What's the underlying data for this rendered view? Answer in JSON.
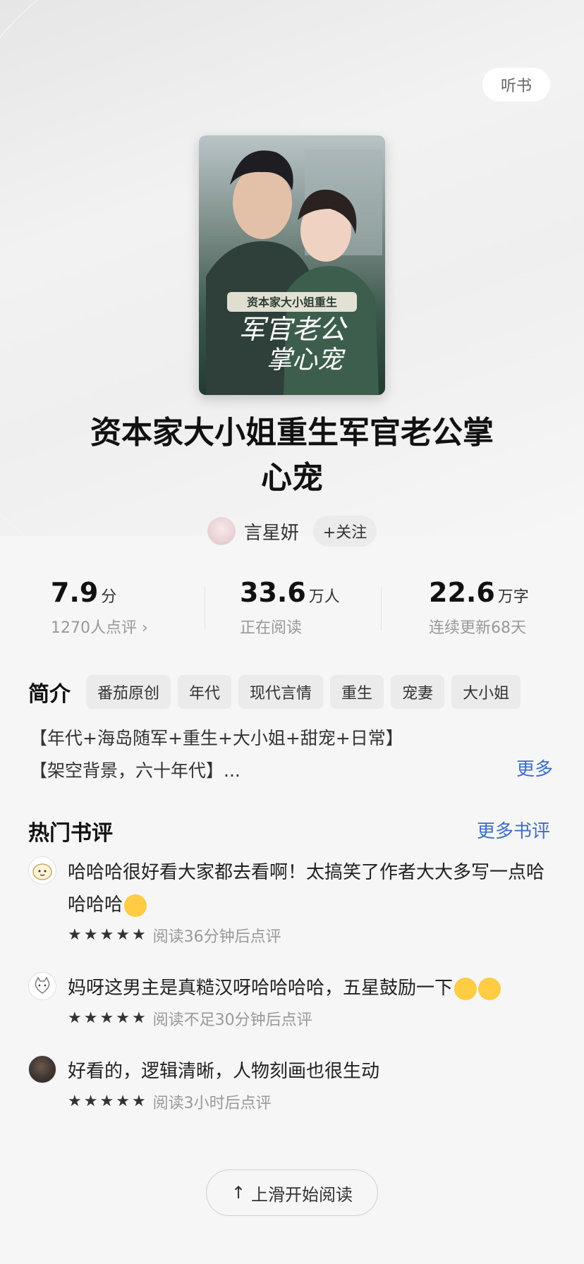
{
  "header": {
    "listen_label": "听书"
  },
  "book": {
    "cover_small_title": "资本家大小姐重生",
    "cover_big_title_1": "军官老公",
    "cover_big_title_2": "掌心宠",
    "title": "资本家大小姐重生军官老公掌心宠"
  },
  "author": {
    "name": "言星妍",
    "follow_label": "+关注"
  },
  "stats": {
    "score": "7.9",
    "score_unit": "分",
    "score_sub": "1270人点评 ›",
    "readers": "33.6",
    "readers_unit": "万人",
    "readers_sub": "正在阅读",
    "words": "22.6",
    "words_unit": "万字",
    "words_sub": "连续更新68天"
  },
  "intro": {
    "label": "简介",
    "tags": [
      "番茄原创",
      "年代",
      "现代言情",
      "重生",
      "宠妻",
      "大小姐"
    ],
    "line1": "【年代+海岛随军+重生+大小姐+甜宠+日常】",
    "line2": "【架空背景，六十年代】...",
    "more_label": "更多"
  },
  "reviews": {
    "title": "热门书评",
    "more_label": "更多书评",
    "items": [
      {
        "text": "哈哈哈很好看大家都去看啊！太搞笑了作者大大多写一点哈哈哈哈",
        "meta": "阅读36分钟后点评",
        "avatar_icon": "bun-avatar-icon",
        "emoji_icon": "grinning-face-icon"
      },
      {
        "text": "妈呀这男主是真糙汉呀哈哈哈哈，五星鼓励一下",
        "meta": "阅读不足30分钟后点评",
        "avatar_icon": "cat-avatar-icon",
        "emoji_icon": "smirk-face-icon"
      },
      {
        "text": "好看的，逻辑清晰，人物刻画也很生动",
        "meta": "阅读3小时后点评",
        "avatar_icon": "photo-avatar-icon"
      }
    ]
  },
  "footer": {
    "start_label": "上滑开始阅读",
    "arrow_icon": "arrow-up-icon"
  },
  "colors": {
    "link": "#3c6ec7",
    "background": "#f6f6f6"
  }
}
